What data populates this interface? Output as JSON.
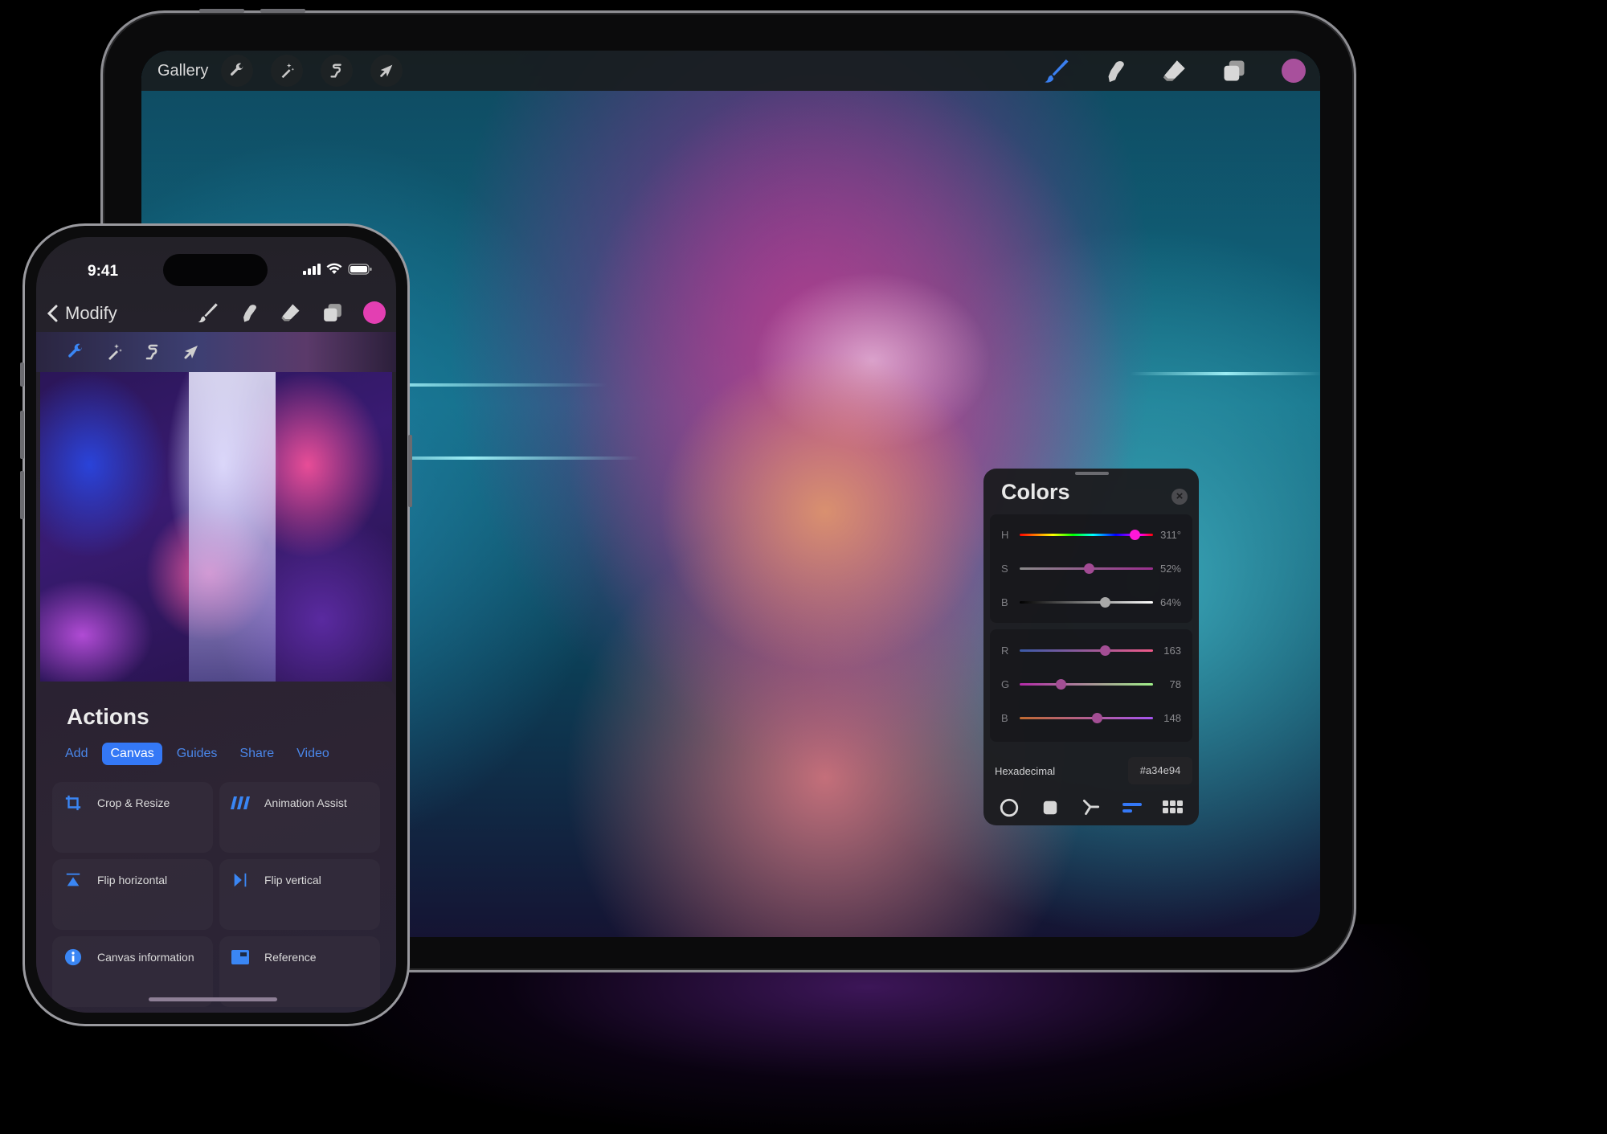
{
  "ipad": {
    "toolbar": {
      "gallery_label": "Gallery",
      "left_tools": [
        {
          "name": "actions",
          "icon": "wrench-icon"
        },
        {
          "name": "adjustments",
          "icon": "magic-wand-icon"
        },
        {
          "name": "selection",
          "icon": "selection-s-icon"
        },
        {
          "name": "transform",
          "icon": "arrow-cursor-icon"
        }
      ],
      "right_tools": [
        {
          "name": "brush",
          "icon": "brush-icon",
          "active": true
        },
        {
          "name": "smudge",
          "icon": "smudge-finger-icon"
        },
        {
          "name": "eraser",
          "icon": "eraser-icon"
        },
        {
          "name": "layers",
          "icon": "layers-icon"
        }
      ],
      "current_color": "#a8509c"
    },
    "colors_panel": {
      "title": "Colors",
      "hsb": [
        {
          "label": "H",
          "value": "311°",
          "fraction": 0.864
        },
        {
          "label": "S",
          "value": "52%",
          "fraction": 0.52
        },
        {
          "label": "B",
          "value": "64%",
          "fraction": 0.64
        }
      ],
      "rgb": [
        {
          "label": "R",
          "value": "163",
          "fraction": 0.639
        },
        {
          "label": "G",
          "value": "78",
          "fraction": 0.306
        },
        {
          "label": "B",
          "value": "148",
          "fraction": 0.58
        }
      ],
      "hex_label": "Hexadecimal",
      "hex_value": "#a34e94",
      "modes": [
        "disc-icon",
        "classic-square-icon",
        "harmony-icon",
        "value-sliders-icon",
        "palettes-grid-icon"
      ],
      "active_mode": "value-sliders-icon",
      "accent": "#3478f6"
    }
  },
  "phone": {
    "status": {
      "time": "9:41"
    },
    "nav": {
      "back_label": "Modify",
      "tools": [
        "brush-icon",
        "smudge-finger-icon",
        "eraser-icon",
        "layers-icon"
      ],
      "current_color": "#e33fb2"
    },
    "subtools": [
      "wrench-icon",
      "magic-wand-icon",
      "selection-s-icon",
      "arrow-cursor-icon"
    ],
    "actions": {
      "title": "Actions",
      "tabs": [
        {
          "label": "Add",
          "active": false
        },
        {
          "label": "Canvas",
          "active": true
        },
        {
          "label": "Guides",
          "active": false
        },
        {
          "label": "Share",
          "active": false
        },
        {
          "label": "Video",
          "active": false
        }
      ],
      "items": [
        {
          "label": "Crop & Resize",
          "icon": "crop-icon"
        },
        {
          "label": "Animation Assist",
          "icon": "animation-assist-icon"
        },
        {
          "label": "Flip horizontal",
          "icon": "flip-horizontal-icon"
        },
        {
          "label": "Flip vertical",
          "icon": "flip-vertical-icon"
        },
        {
          "label": "Canvas information",
          "icon": "info-icon"
        },
        {
          "label": "Reference",
          "icon": "reference-icon"
        }
      ]
    }
  }
}
